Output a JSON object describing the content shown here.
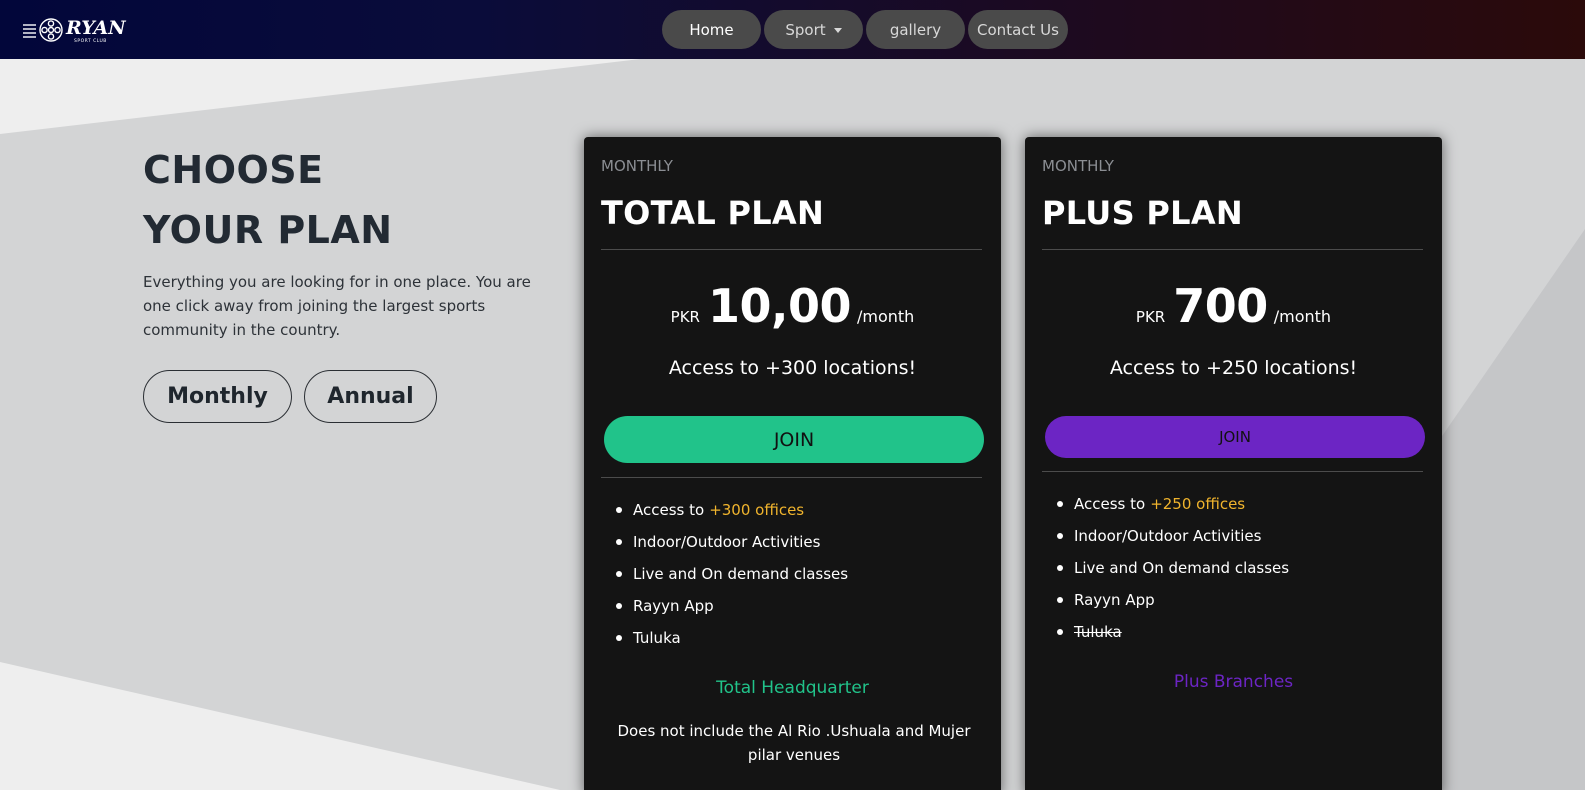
{
  "brand": {
    "name": "RYAN",
    "tagline": "SPORT CLUB",
    "logo_icon": "film-reel-icon"
  },
  "nav": {
    "items": [
      {
        "label": "Home",
        "active": true
      },
      {
        "label": "Sport",
        "dropdown": true
      },
      {
        "label": "gallery"
      },
      {
        "label": "Contact Us"
      }
    ]
  },
  "hero": {
    "heading_line1": "CHOOSE",
    "heading_line2": "YOUR PLAN",
    "intro": "Everything you are looking for in one place. You are one click away from joining the largest sports community in the country.",
    "toggle_monthly": "Monthly",
    "toggle_annual": "Annual"
  },
  "plans": [
    {
      "period": "MONTHLY",
      "title": "TOTAL PLAN",
      "currency": "PKR",
      "amount": "10,00",
      "per": "/month",
      "access": "Access to +300 locations!",
      "join_label": "JOIN",
      "features": [
        {
          "text": "Access to",
          "highlight": "+300 offices"
        },
        {
          "text": "Indoor/Outdoor Activities"
        },
        {
          "text": "Live and On demand classes"
        },
        {
          "text": "Rayyn App"
        },
        {
          "text": "Tuluka"
        }
      ],
      "branch": "Total Headquarter",
      "note": "Does not include the Al Rio .Ushuala and Mujer pilar venues"
    },
    {
      "period": "MONTHLY",
      "title": "PLUS PLAN",
      "currency": "PKR",
      "amount": "700",
      "per": "/month",
      "access": "Access to +250 locations!",
      "join_label": "JOIN",
      "features": [
        {
          "text": "Access to",
          "highlight": "+250 offices"
        },
        {
          "text": "Indoor/Outdoor Activities"
        },
        {
          "text": "Live and On demand classes"
        },
        {
          "text": "Rayyn App"
        },
        {
          "text": "Tuluka",
          "strikethrough": true
        }
      ],
      "branch": "Plus Branches"
    }
  ],
  "colors": {
    "accent_total": "#21c38a",
    "accent_plus": "#6c25c4",
    "highlight": "#f0b42d",
    "card_bg": "#141414"
  }
}
